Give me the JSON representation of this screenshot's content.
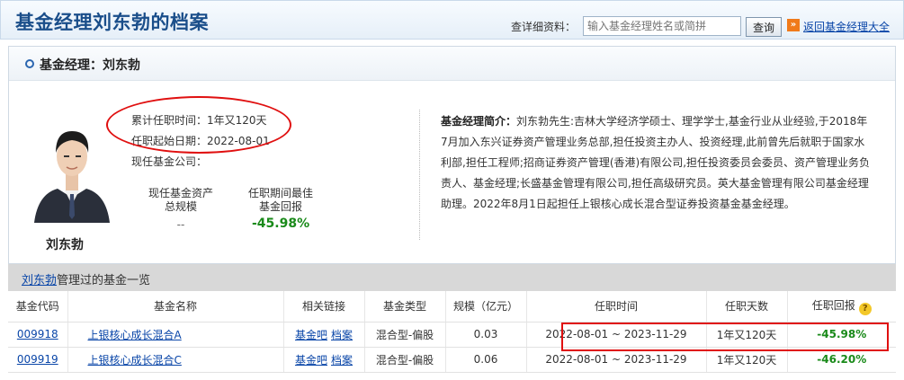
{
  "header": {
    "title": "基金经理刘东勃的档案",
    "search_label": "查详细资料：",
    "search_placeholder": "输入基金经理姓名或简拼",
    "search_button": "查询",
    "back_link": "返回基金经理大全"
  },
  "manager": {
    "panel_title": "基金经理：刘东勃",
    "name": "刘东勃",
    "tenure_label": "累计任职时间：",
    "tenure_value": "1年又120天",
    "start_label": "任职起始日期：",
    "start_value": "2022-08-01",
    "current_company_label": "现任基金公司：",
    "current_company_value": "",
    "assets_label_line1": "现任基金资产",
    "assets_label_line2": "总规模",
    "assets_value": "--",
    "best_return_label_line1": "任职期间最佳",
    "best_return_label_line2": "基金回报",
    "best_return_value": "-45.98%",
    "bio_label": "基金经理简介：",
    "bio_text": "刘东勃先生:吉林大学经济学硕士、理学学士,基金行业从业经验,于2018年7月加入东兴证券资产管理业务总部,担任投资主办人、投资经理,此前曾先后就职于国家水利部,担任工程师;招商证券资产管理(香港)有限公司,担任投资委员会委员、资产管理业务负责人、基金经理;长盛基金管理有限公司,担任高级研究员。英大基金管理有限公司基金经理助理。2022年8月1日起担任上银核心成长混合型证券投资基金基金经理。"
  },
  "funds": {
    "title_link": "刘东勃",
    "title_suffix": "管理过的基金一览",
    "columns": [
      "基金代码",
      "基金名称",
      "相关链接",
      "基金类型",
      "规模（亿元）",
      "任职时间",
      "任职天数",
      "任职回报"
    ],
    "rows": [
      {
        "code": "009918",
        "name": "上银核心成长混合A",
        "link1": "基金吧",
        "link2": "档案",
        "type": "混合型-偏股",
        "size": "0.03",
        "period": "2022-08-01 ~ 2023-11-29",
        "days": "1年又120天",
        "return": "-45.98%"
      },
      {
        "code": "009919",
        "name": "上银核心成长混合C",
        "link1": "基金吧",
        "link2": "档案",
        "type": "混合型-偏股",
        "size": "0.06",
        "period": "2022-08-01 ~ 2023-11-29",
        "days": "1年又120天",
        "return": "-46.20%"
      }
    ]
  },
  "colors": {
    "title_blue": "#1a4e8a",
    "link_blue": "#0a46a8",
    "return_green": "#1a8a1a",
    "annotation_red": "#e01010"
  }
}
